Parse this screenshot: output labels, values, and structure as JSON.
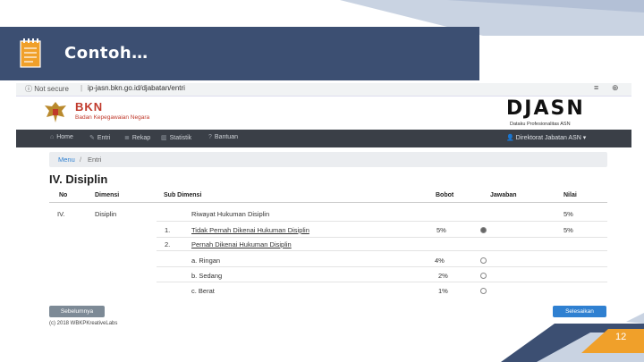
{
  "slide": {
    "title": "Contoh…",
    "page_number": "12",
    "colors": {
      "title_bar": "#3c4f72",
      "accent_orange": "#f0a02a",
      "light_blue": "#c5d0e0"
    }
  },
  "browser": {
    "security_label": "Not secure",
    "url": "ip-jasn.bkn.go.id/djabatan/entri"
  },
  "header": {
    "org_name": "BKN",
    "org_subtitle": "Badan Kepegawaian Negara",
    "app_name": "DJASN",
    "app_subtitle": "Dataku Profesionalitas ASN"
  },
  "nav": {
    "items": [
      "Home",
      "Entri",
      "Rekap",
      "Statistik",
      "Bantuan"
    ],
    "user": "Direktorat Jabatan ASN"
  },
  "breadcrumb": {
    "home": "Menu",
    "sep": "/",
    "current": "Entri"
  },
  "section_title": "IV. Disiplin",
  "table": {
    "headers": [
      "No",
      "Dimensi",
      "Sub Dimensi",
      "Bobot",
      "Jawaban",
      "Nilai"
    ],
    "rows": [
      {
        "no": "IV.",
        "dimensi": "Disiplin",
        "sub_no": "",
        "sub": "Riwayat Hukuman Disiplin",
        "bobot": "",
        "jawaban": false,
        "nilai": "5%"
      },
      {
        "no": "",
        "dimensi": "",
        "sub_no": "1.",
        "sub": "Tidak Pernah Dikenai Hukuman Disiplin",
        "bobot": "5%",
        "jawaban": true,
        "nilai": "5%"
      },
      {
        "no": "",
        "dimensi": "",
        "sub_no": "2.",
        "sub": "Pernah Dikenai Hukuman Disiplin",
        "bobot": "",
        "jawaban": false,
        "nilai": ""
      },
      {
        "no": "",
        "dimensi": "",
        "sub_no": "",
        "sub": "a. Ringan",
        "bobot": "4%",
        "jawaban": true,
        "nilai": ""
      },
      {
        "no": "",
        "dimensi": "",
        "sub_no": "",
        "sub": "b. Sedang",
        "bobot": "2%",
        "jawaban": true,
        "nilai": ""
      },
      {
        "no": "",
        "dimensi": "",
        "sub_no": "",
        "sub": "c. Berat",
        "bobot": "1%",
        "jawaban": true,
        "nilai": ""
      }
    ]
  },
  "buttons": {
    "prev": "Sebelumnya",
    "finish": "Selesaikan"
  },
  "footer": "(c) 2018 WBKPKreativeLabs"
}
